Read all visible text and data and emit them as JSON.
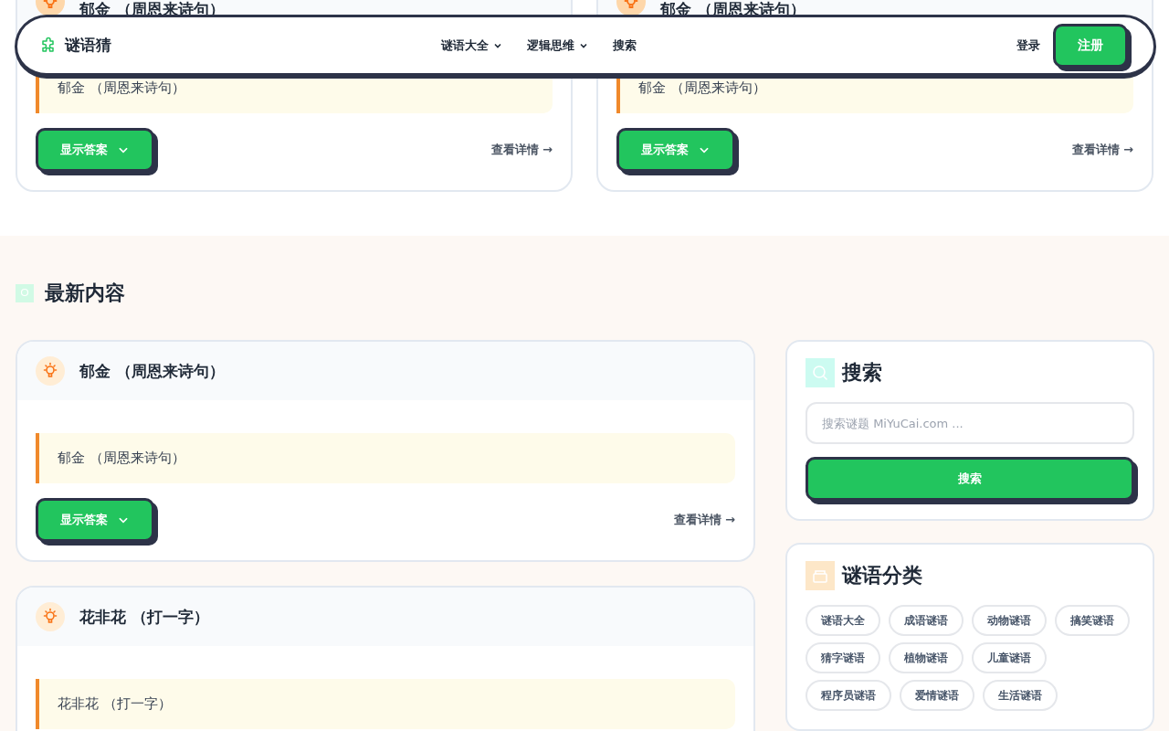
{
  "nav": {
    "brand": "谜语猜",
    "menu": [
      {
        "label": "谜语大全",
        "dropdown": true
      },
      {
        "label": "逻辑思维",
        "dropdown": true
      },
      {
        "label": "搜索",
        "dropdown": false
      }
    ],
    "login": "登录",
    "register": "注册"
  },
  "top_cards": [
    {
      "title": "郁金 （周恩来诗句）",
      "quote": "郁金 （周恩来诗句）",
      "button": "显示答案",
      "link": "查看详情 →"
    },
    {
      "title": "郁金 （周恩来诗句）",
      "quote": "郁金 （周恩来诗句）",
      "button": "显示答案",
      "link": "查看详情 →"
    }
  ],
  "latest": {
    "heading": "最新内容",
    "cards": [
      {
        "title": "郁金 （周恩来诗句）",
        "quote": "郁金 （周恩来诗句）",
        "button": "显示答案",
        "link": "查看详情 →"
      },
      {
        "title": "花非花 （打一字）",
        "quote": "花非花 （打一字）"
      }
    ]
  },
  "sidebar": {
    "search": {
      "title": "搜索",
      "placeholder": "搜索谜题 MiYuCai.com ...",
      "button": "搜索"
    },
    "categories": {
      "title": "谜语分类",
      "tags": [
        "谜语大全",
        "成语谜语",
        "动物谜语",
        "搞笑谜语",
        "猜字谜语",
        "植物谜语",
        "儿童谜语",
        "程序员谜语",
        "爱情谜语",
        "生活谜语"
      ]
    }
  }
}
